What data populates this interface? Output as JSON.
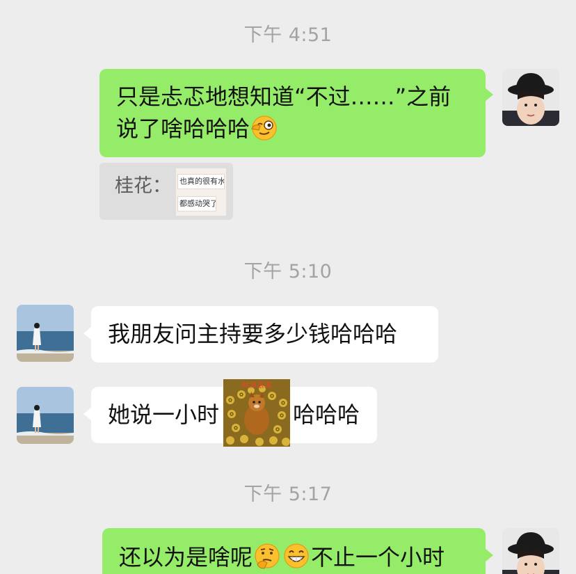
{
  "timestamps": [
    "下午 4:51",
    "下午 5:10",
    "下午 5:17"
  ],
  "messages": [
    {
      "line1": "只是忐忑地想知道“不过……”之前",
      "line2": "说了啥哈哈哈",
      "emoji": "wink-emoji"
    },
    {
      "quote_name": "桂花：",
      "quote_lines": [
        "也真的很有水平",
        "都感动哭了"
      ]
    },
    {
      "text": "我朋友问主持要多少钱哈哈哈"
    },
    {
      "text_before": "她说一小时",
      "sticker": "money-dog-sticker",
      "sticker_caption": "财源滚滚",
      "text_after": "哈哈哈"
    },
    {
      "text": "还以为是啥呢",
      "emojis": [
        "thinking-emoji",
        "grin-emoji"
      ],
      "text_after": "不止一个小时"
    }
  ],
  "colors": {
    "background": "#ededed",
    "sent_bubble": "#95ec69",
    "received_bubble": "#ffffff",
    "timestamp": "#a3a3a3"
  }
}
